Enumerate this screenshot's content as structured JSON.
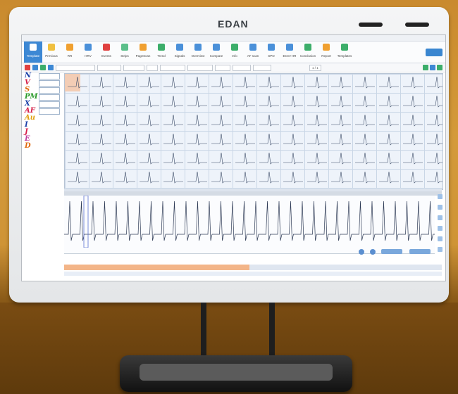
{
  "monitor": {
    "brand": "EDAN"
  },
  "app": {
    "title": "",
    "toolbar": [
      {
        "label": "Template",
        "color": "#3d88d4",
        "active": true
      },
      {
        "label": "Previous",
        "color": "#f0c040"
      },
      {
        "label": "RR",
        "color": "#f0a030"
      },
      {
        "label": "HRV",
        "color": "#4a90d9"
      },
      {
        "label": "Events",
        "color": "#e04040"
      },
      {
        "label": "Strips",
        "color": "#5bbf8a"
      },
      {
        "label": "PageScan",
        "color": "#f0a030"
      },
      {
        "label": "Trend",
        "color": "#3cae6a"
      },
      {
        "label": "Signals",
        "color": "#4a90d9"
      },
      {
        "label": "Overview",
        "color": "#4a90d9"
      },
      {
        "label": "Compare",
        "color": "#4a90d9"
      },
      {
        "label": "Info",
        "color": "#3cae6a"
      },
      {
        "label": "AF scan",
        "color": "#4a90d9"
      },
      {
        "label": "SPO",
        "color": "#4a90d9"
      },
      {
        "label": "ECG+HR",
        "color": "#4a90d9"
      },
      {
        "label": "Conclusion",
        "color": "#3cae6a"
      },
      {
        "label": "Report",
        "color": "#f0a030"
      },
      {
        "label": "Templates",
        "color": "#3cae6a"
      }
    ],
    "user_button": "",
    "pager": "1 / 1"
  },
  "left_labels": [
    {
      "text": "N",
      "color": "#1a3fa8"
    },
    {
      "text": "V",
      "color": "#d6204a"
    },
    {
      "text": "S",
      "color": "#e06a10"
    },
    {
      "text": "PM",
      "color": "#2a9a2a"
    },
    {
      "text": "X",
      "color": "#1a3fa8"
    },
    {
      "text": "AF",
      "color": "#d6204a"
    },
    {
      "text": "Au",
      "color": "#e0a010"
    },
    {
      "text": "I",
      "color": "#1a3fa8"
    },
    {
      "text": "J",
      "color": "#d6204a"
    },
    {
      "text": "E",
      "color": "#c040a0"
    },
    {
      "text": "D",
      "color": "#e06a10"
    }
  ],
  "strip": {
    "time": ""
  },
  "progress": {
    "label": "",
    "fraction": 0.49
  },
  "colors": {
    "accent": "#3d88d4",
    "grid": "#c9d6e6",
    "highlight": "#f3c9ad"
  }
}
